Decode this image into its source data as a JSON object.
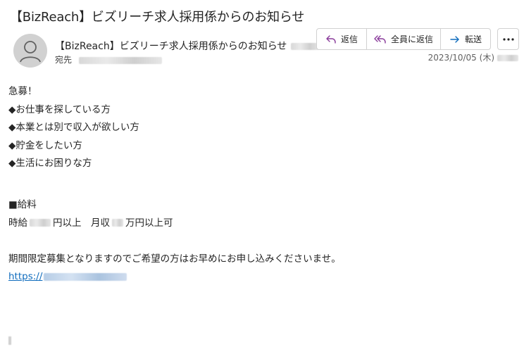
{
  "subject": "【BizReach】ビズリーチ求人採用係からのお知らせ",
  "sender": {
    "name": "【BizReach】ビズリーチ求人採用係からのお知らせ",
    "to_label": "宛先"
  },
  "actions": {
    "reply": "返信",
    "reply_all": "全員に返信",
    "forward": "転送"
  },
  "date": "2023/10/05 (木)",
  "body": {
    "l1": "急募！",
    "l2": "◆お仕事を探している方",
    "l3": "◆本業とは別で収入が欲しい方",
    "l4": "◆貯金をしたい方",
    "l5": "◆生活にお困りな方",
    "salary_header": "■給料",
    "hourly_prefix": "時給",
    "hourly_suffix": "円以上　月収",
    "monthly_suffix": "万円以上可",
    "notice": "期間限定募集となりますのでご希望の方はお早めにお申し込みくださいませ。",
    "link_prefix": "https://"
  },
  "colors": {
    "link": "#0f6cbd",
    "reply_icon": "#8a3b9b",
    "forward_icon": "#0f6cbd"
  }
}
